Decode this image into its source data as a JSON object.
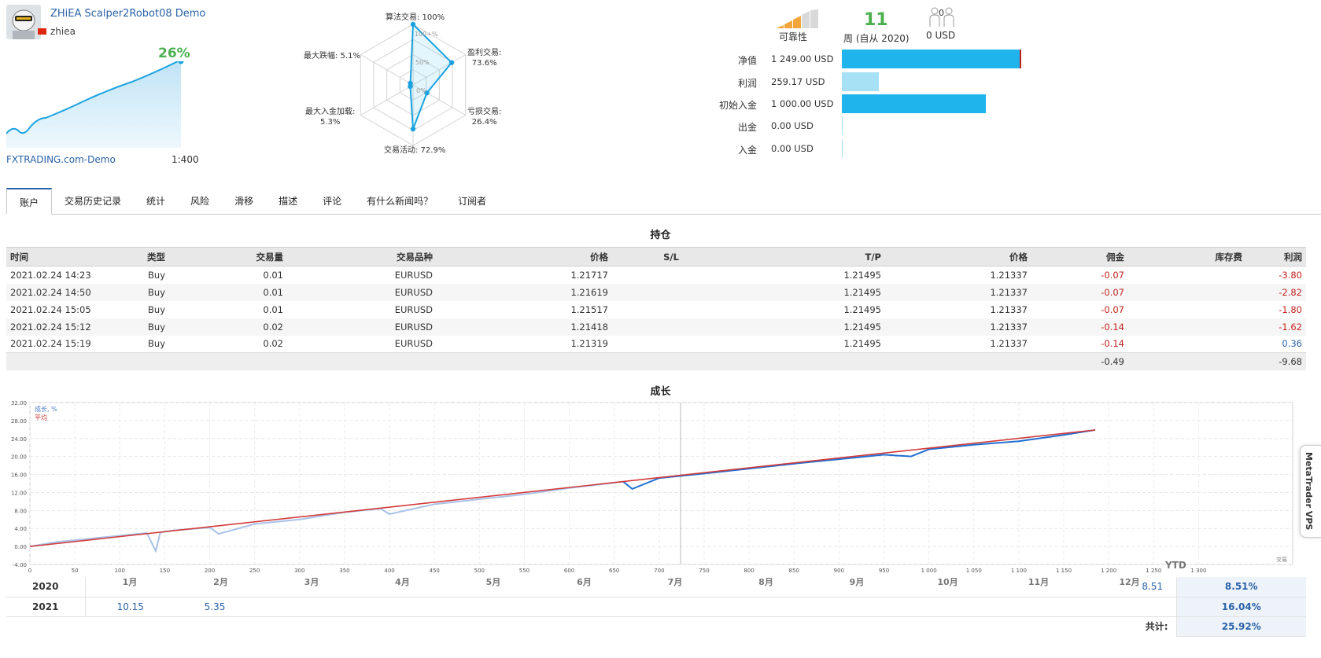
{
  "signal": {
    "title": "ZHiEA Scalper2Robot08 Demo",
    "author": "zhiea",
    "growth": "26%",
    "broker": "FXTRADING.com-Demo",
    "leverage": "1:400"
  },
  "radar": {
    "axes": [
      {
        "label": "算法交易: 100%",
        "value": 100
      },
      {
        "label": "盈利交易:",
        "sub": "73.6%",
        "value": 73.6
      },
      {
        "label": "亏损交易:",
        "sub": "26.4%",
        "value": 26.4
      },
      {
        "label": "交易活动: 72.9%",
        "value": 72.9
      },
      {
        "label": "最大入金加载:",
        "sub": "5.3%",
        "value": 5.3
      },
      {
        "label": "最大跌幅: 5.1%",
        "value": 5.1
      }
    ],
    "rings": [
      "100+%",
      "50%",
      "0%"
    ]
  },
  "stats": {
    "reliability_label": "可靠性",
    "weeks": "11",
    "weeks_label": "周 (自从 2020)",
    "subscribers": "0",
    "subscribers_label": "0 USD"
  },
  "balance": [
    {
      "label": "净值",
      "value": "1 249.00 USD",
      "amount": 1249,
      "color": "#1fb5ec"
    },
    {
      "label": "利润",
      "value": "259.17 USD",
      "amount": 259.17,
      "color": "#a7e1f6"
    },
    {
      "label": "初始入金",
      "value": "1 000.00 USD",
      "amount": 1000,
      "color": "#1fb5ec"
    },
    {
      "label": "出金",
      "value": "0.00 USD",
      "amount": 0,
      "color": "#1fb5ec"
    },
    {
      "label": "入金",
      "value": "0.00 USD",
      "amount": 0,
      "color": "#1fb5ec"
    }
  ],
  "tabs": [
    "账户",
    "交易历史记录",
    "统计",
    "风险",
    "滑移",
    "描述",
    "评论",
    "有什么新闻吗？",
    "订阅者"
  ],
  "positions": {
    "title": "持仓",
    "headers": [
      "时间",
      "类型",
      "交易量",
      "交易品种",
      "价格",
      "S/L",
      "T/P",
      "价格",
      "佣金",
      "库存费",
      "利润"
    ],
    "rows": [
      [
        "2021.02.24 14:23",
        "Buy",
        "0.01",
        "EURUSD",
        "1.21717",
        "",
        "1.21495",
        "1.21337",
        "-0.07",
        "",
        "-3.80"
      ],
      [
        "2021.02.24 14:50",
        "Buy",
        "0.01",
        "EURUSD",
        "1.21619",
        "",
        "1.21495",
        "1.21337",
        "-0.07",
        "",
        "-2.82"
      ],
      [
        "2021.02.24 15:05",
        "Buy",
        "0.01",
        "EURUSD",
        "1.21517",
        "",
        "1.21495",
        "1.21337",
        "-0.07",
        "",
        "-1.80"
      ],
      [
        "2021.02.24 15:12",
        "Buy",
        "0.02",
        "EURUSD",
        "1.21418",
        "",
        "1.21495",
        "1.21337",
        "-0.14",
        "",
        "-1.62"
      ],
      [
        "2021.02.24 15:19",
        "Buy",
        "0.02",
        "EURUSD",
        "1.21319",
        "",
        "1.21495",
        "1.21337",
        "-0.14",
        "",
        "0.36"
      ]
    ],
    "totals": {
      "commission": "-0.49",
      "profit": "-9.68"
    }
  },
  "growth": {
    "title": "成长",
    "legend_growth": "成长, %",
    "legend_avg": "平均",
    "trades_label": "交易",
    "yticks": [
      "32.00",
      "28.00",
      "24.00",
      "20.00",
      "16.00",
      "12.00",
      "8.00",
      "4.00",
      "0.00",
      "-4.00"
    ],
    "xticks": [
      "0",
      "50",
      "100",
      "150",
      "200",
      "250",
      "300",
      "350",
      "400",
      "450",
      "500",
      "550",
      "600",
      "650",
      "700",
      "750",
      "800",
      "850",
      "900",
      "950",
      "1 000",
      "1 050",
      "1 100",
      "1 150",
      "1 200",
      "1 250",
      "1 300"
    ],
    "months": [
      "1月",
      "2月",
      "3月",
      "4月",
      "5月",
      "6月",
      "7月",
      "8月",
      "9月",
      "10月",
      "11月",
      "12月"
    ]
  },
  "monthly": {
    "ytd_label": "YTD",
    "rows": [
      {
        "year": "2020",
        "months": [
          "",
          "",
          "",
          "",
          "",
          "",
          "",
          "",
          "",
          "",
          "",
          "8.51"
        ],
        "ytd": "8.51%"
      },
      {
        "year": "2021",
        "months": [
          "10.15",
          "5.35",
          "",
          "",
          "",
          "",
          "",
          "",
          "",
          "",
          "",
          ""
        ],
        "ytd": "16.04%"
      }
    ],
    "total_label": "共计:",
    "total": "25.92%"
  },
  "chart_data": {
    "type": "line",
    "title": "成长",
    "xlabel": "交易",
    "ylabel": "",
    "xlim": [
      0,
      1300
    ],
    "ylim": [
      -4,
      32
    ],
    "series": [
      {
        "name": "成长, %",
        "x": [
          0,
          30,
          60,
          100,
          130,
          140,
          145,
          160,
          200,
          210,
          250,
          300,
          350,
          390,
          400,
          450,
          500,
          550,
          600,
          660,
          670,
          700,
          750,
          800,
          850,
          900,
          950,
          980,
          1000,
          1050,
          1100,
          1150,
          1185
        ],
        "y": [
          0,
          1,
          1.6,
          2.4,
          3.0,
          -1.0,
          3.1,
          3.6,
          4.2,
          2.8,
          5.0,
          6.0,
          7.6,
          8.4,
          7.2,
          9.4,
          10.5,
          11.6,
          13.0,
          14.4,
          12.8,
          15.2,
          16.2,
          17.3,
          18.4,
          19.4,
          20.4,
          20.0,
          21.6,
          22.6,
          23.4,
          24.8,
          25.9
        ]
      },
      {
        "name": "平均",
        "x": [
          0,
          1185
        ],
        "y": [
          0,
          25.9
        ]
      }
    ],
    "grid": true
  },
  "vps": {
    "label": "MetaTrader VPS"
  }
}
